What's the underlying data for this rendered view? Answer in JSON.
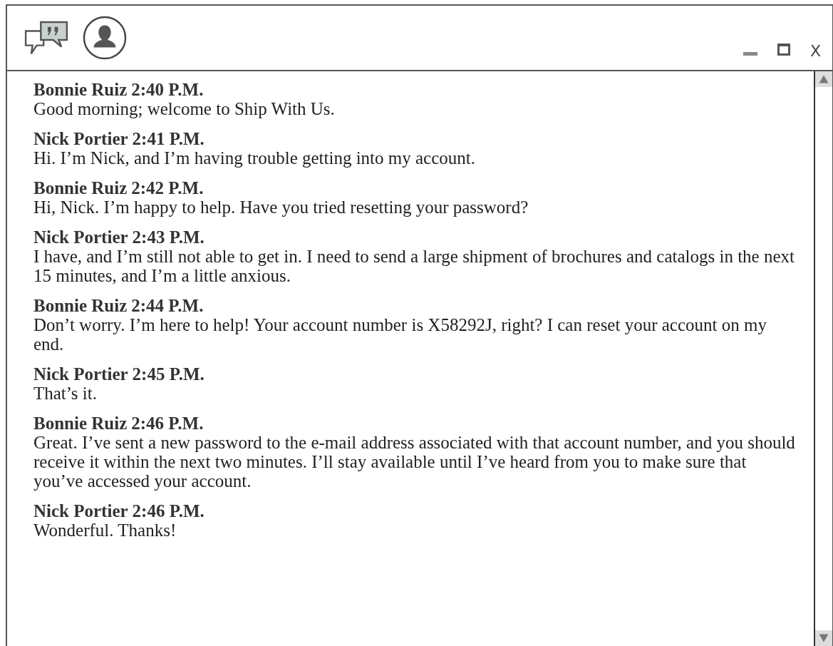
{
  "window": {
    "close_label": "X"
  },
  "messages": [
    {
      "author": "Bonnie Ruiz",
      "time": "2:40 P.M.",
      "text": "Good morning; welcome to Ship With Us."
    },
    {
      "author": "Nick Portier",
      "time": "2:41 P.M.",
      "text": "Hi. I’m Nick, and I’m having trouble getting into my account."
    },
    {
      "author": "Bonnie Ruiz",
      "time": "2:42 P.M.",
      "text": "Hi, Nick. I’m happy to help. Have you tried resetting your password?"
    },
    {
      "author": "Nick Portier",
      "time": "2:43 P.M.",
      "text": "I have, and I’m still not able to get in. I need to send a large shipment of brochures and catalogs in the next 15 minutes, and I’m a little anxious."
    },
    {
      "author": "Bonnie Ruiz",
      "time": "2:44 P.M.",
      "text": "Don’t worry. I’m here to help! Your account number is X58292J, right? I can reset your account on my end."
    },
    {
      "author": "Nick Portier",
      "time": "2:45 P.M.",
      "text": "That’s it."
    },
    {
      "author": "Bonnie Ruiz",
      "time": "2:46 P.M.",
      "text": "Great. I’ve sent a new password to the e-mail address associated with that account number, and you should receive it within the next two minutes. I’ll stay available until I’ve heard from you to make sure that you’ve accessed your account."
    },
    {
      "author": "Nick Portier",
      "time": "2:46 P.M.",
      "text": "Wonderful. Thanks!"
    }
  ]
}
